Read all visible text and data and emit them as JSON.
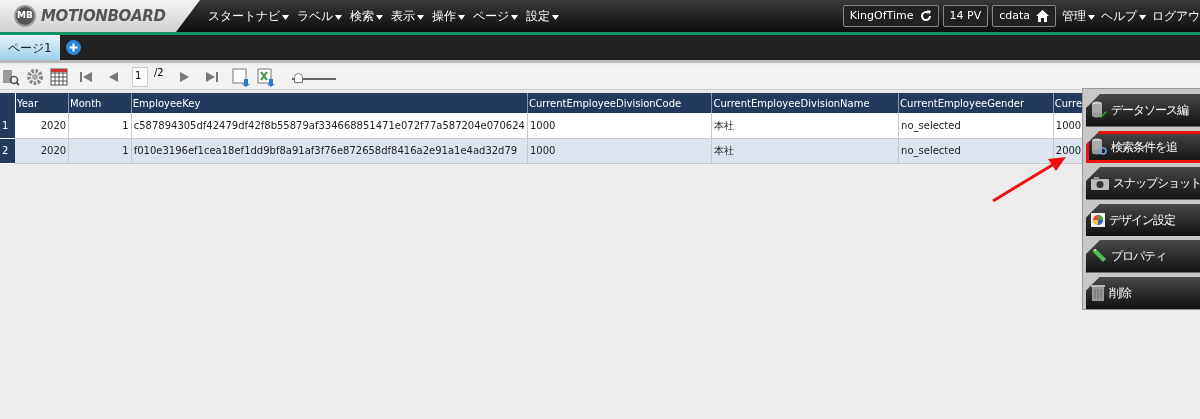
{
  "header": {
    "logo_mark": "MB",
    "logo_text": "MOTIONBOARD",
    "menus": [
      {
        "label": "スタートナビ"
      },
      {
        "label": "ラベル"
      },
      {
        "label": "検索"
      },
      {
        "label": "表示"
      },
      {
        "label": "操作"
      },
      {
        "label": "ページ"
      },
      {
        "label": "設定"
      }
    ],
    "badges": [
      {
        "label": "KingOfTime",
        "kind": "refresh"
      },
      {
        "label": "14 PV",
        "kind": "none"
      },
      {
        "label": "cdata",
        "kind": "home"
      }
    ],
    "right_menus": [
      {
        "label": "管理",
        "caret": true
      },
      {
        "label": "ヘルプ",
        "caret": true
      },
      {
        "label": "ログアウ",
        "caret": false
      }
    ]
  },
  "tabs": [
    {
      "label": "ページ1",
      "selected": true
    }
  ],
  "toolbar": {
    "page": "1",
    "page_total": "/2",
    "zoom": {
      "level": 0.15
    }
  },
  "table": {
    "columns": [
      "Year",
      "Month",
      "EmployeeKey",
      "CurrentEmployeeDivisionCode",
      "CurrentEmployeeDivisionName",
      "CurrentEmployeeGender",
      "Curre"
    ],
    "rows": [
      {
        "index": "1",
        "selected": false,
        "cells": [
          "2020",
          "1",
          "c587894305df42479df42f8b55879af334668851471e072f77a587204e070624",
          "1000",
          "本社",
          "no_selected",
          "1000"
        ]
      },
      {
        "index": "2",
        "selected": true,
        "cells": [
          "2020",
          "1",
          "f010e3196ef1cea18ef1dd9bf8a91af3f76e872658df8416a2e91a1e4ad32d79",
          "1000",
          "本社",
          "no_selected",
          "2000"
        ]
      }
    ]
  },
  "context_menu": [
    {
      "label": "データソース編",
      "kind": "datasource",
      "highlighted": false
    },
    {
      "label": "検索条件を追",
      "kind": "search",
      "highlighted": true
    },
    {
      "label": "スナップショット",
      "kind": "snapshot",
      "highlighted": false
    },
    {
      "label": "デザイン設定",
      "kind": "design",
      "highlighted": false
    },
    {
      "label": "プロパティ",
      "kind": "property",
      "highlighted": false
    },
    {
      "label": "削除",
      "kind": "delete",
      "highlighted": false
    }
  ]
}
